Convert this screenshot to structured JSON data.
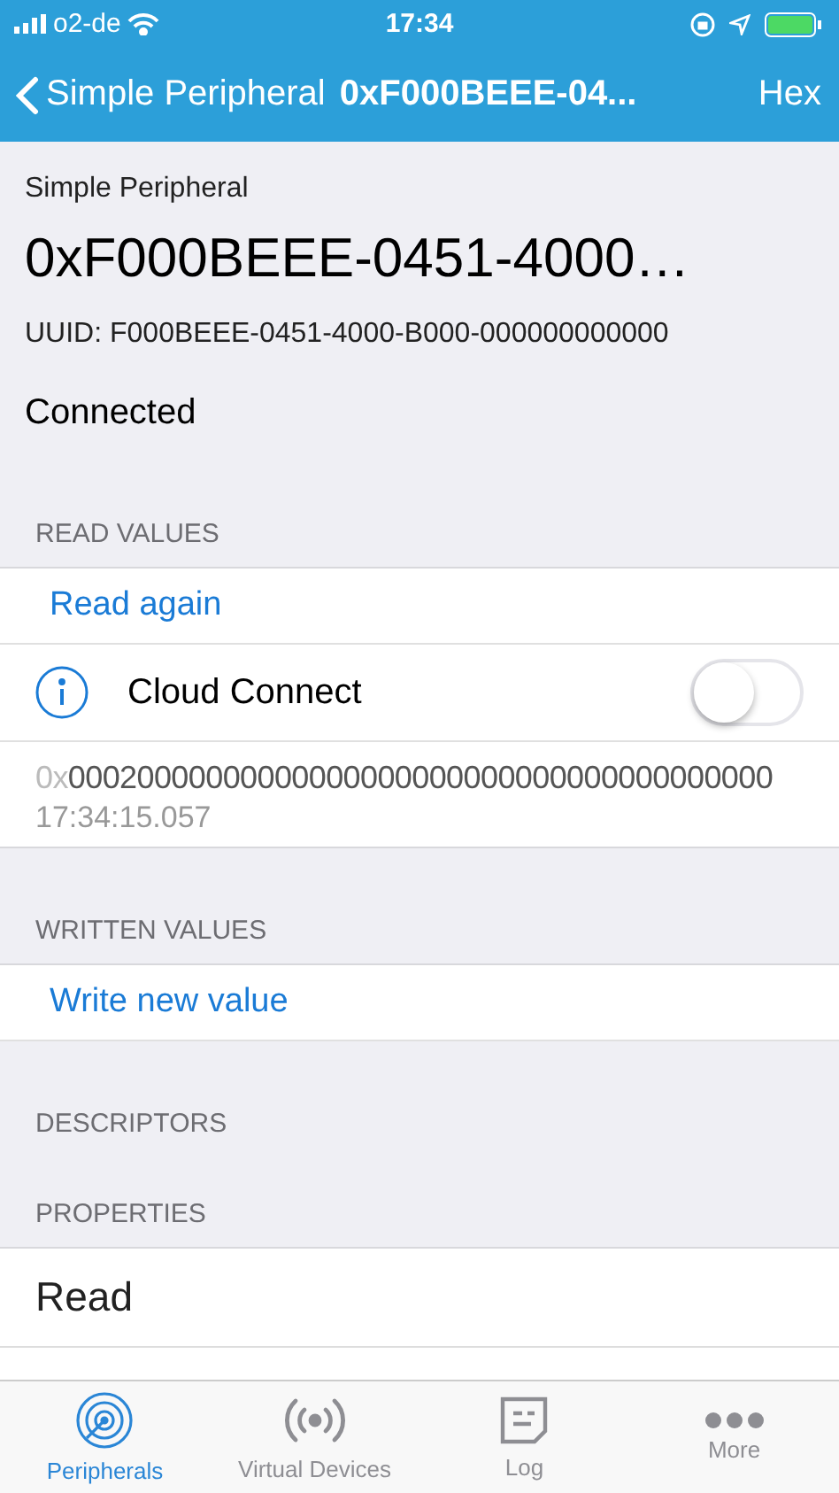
{
  "status_bar": {
    "carrier": "o2-de",
    "time": "17:34"
  },
  "nav": {
    "back": "Simple Peripheral",
    "title": "0xF000BEEE-04...",
    "action": "Hex"
  },
  "header": {
    "service": "Simple Peripheral",
    "name": "0xF000BEEE-0451-4000…",
    "uuid": "UUID: F000BEEE-0451-4000-B000-000000000000",
    "state": "Connected"
  },
  "read_values": {
    "title": "READ VALUES",
    "action": "Read again",
    "notify": {
      "label": "Cloud Connect",
      "on": false
    },
    "value_prefix": "0x",
    "value": "00020000000000000000000000000000000000000",
    "timestamp": "17:34:15.057"
  },
  "written_values": {
    "title": "WRITTEN VALUES",
    "action": "Write new value"
  },
  "descriptors": {
    "title": "DESCRIPTORS"
  },
  "properties": {
    "title": "PROPERTIES",
    "items": [
      "Read"
    ]
  },
  "tabs": [
    {
      "label": "Peripherals",
      "kind": "radar",
      "selected": true
    },
    {
      "label": "Virtual Devices",
      "kind": "broadcast",
      "selected": false
    },
    {
      "label": "Log",
      "kind": "note",
      "selected": false
    },
    {
      "label": "More",
      "kind": "dots",
      "selected": false
    }
  ]
}
